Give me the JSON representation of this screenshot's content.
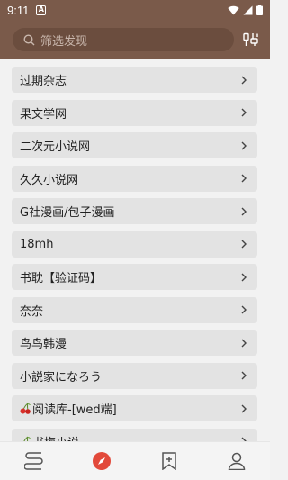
{
  "status_bar": {
    "time": "9:11",
    "notification_badge": "A"
  },
  "search": {
    "placeholder": "筛选发现"
  },
  "colors": {
    "primary": "#7a5a4a",
    "accent": "#e2493a",
    "item_bg": "#e3e3e3"
  },
  "sources": [
    {
      "label": "过期杂志"
    },
    {
      "label": "果文学网"
    },
    {
      "label": "二次元小说网"
    },
    {
      "label": "久久小说网"
    },
    {
      "label": "G社漫画/包子漫画"
    },
    {
      "label": "18mh"
    },
    {
      "label": "书耽【验证码】"
    },
    {
      "label": "奈奈"
    },
    {
      "label": "鸟鸟韩漫"
    },
    {
      "label": "小説家になろう"
    },
    {
      "label": "阅读库-[wed端]",
      "icon": "cherry-icon"
    },
    {
      "label": "书梅小说",
      "icon": "cherry-icon"
    }
  ],
  "bottom_nav": [
    {
      "name": "bookshelf-icon",
      "active": false
    },
    {
      "name": "discover-compass-icon",
      "active": true
    },
    {
      "name": "rss-bookmark-icon",
      "active": false
    },
    {
      "name": "profile-icon",
      "active": false
    }
  ]
}
